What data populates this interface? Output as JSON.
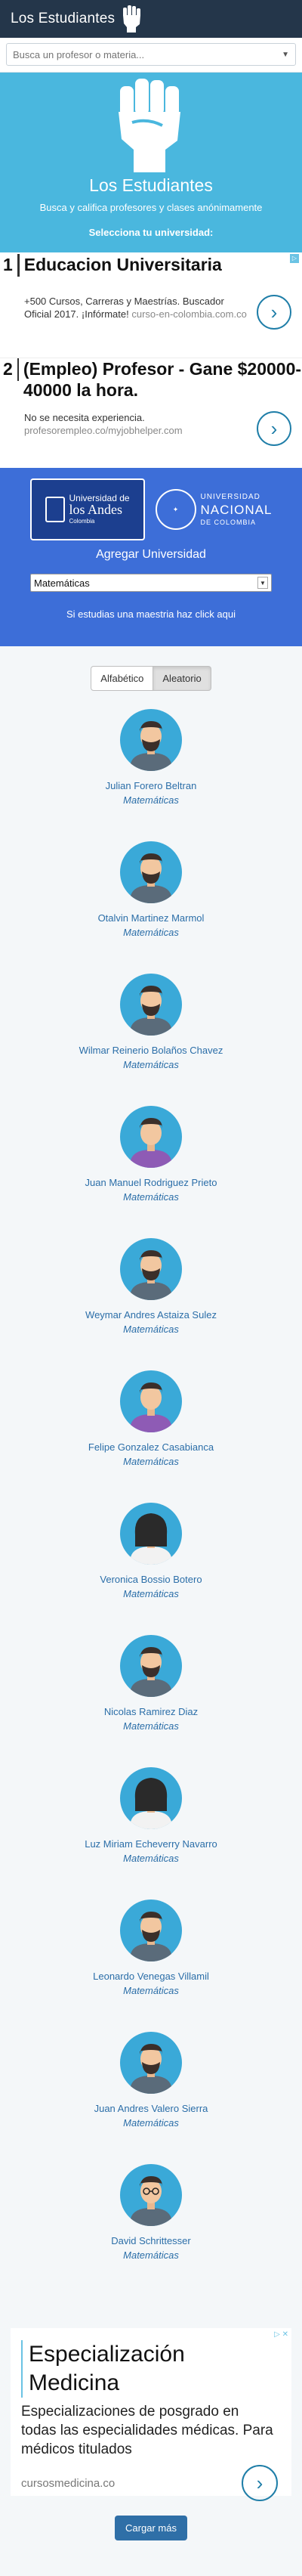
{
  "header": {
    "brand": "Los Estudiantes"
  },
  "search": {
    "placeholder": "Busca un profesor o materia..."
  },
  "hero": {
    "title": "Los Estudiantes",
    "subtitle": "Busca y califica profesores y clases anónimamente",
    "choose": "Selecciona tu universidad:"
  },
  "ads": {
    "ad1": {
      "number": "1",
      "title": "Educacion Universitaria",
      "body": "+500 Cursos, Carreras y Maestrías. Buscador Oficial 2017. ¡Infórmate!",
      "url": "curso-en-colombia.com.co"
    },
    "ad2": {
      "number": "2",
      "title": "(Empleo) Profesor - Gane $20000-40000 la hora.",
      "body": "No se necesita experiencia.",
      "url": "profesorempleo.co/myjobhelper.com"
    },
    "ad3": {
      "title": "Especialización Medicina",
      "body": "Especializaciones de posgrado en todas las especialidades médicas. Para médicos titulados",
      "url": "cursosmedicina.co"
    }
  },
  "universities": {
    "andes": {
      "line1": "Universidad de",
      "line2": "los Andes",
      "line3": "Colombia"
    },
    "nacional": {
      "line1": "UNIVERSIDAD",
      "line2": "NACIONAL",
      "line3": "DE COLOMBIA"
    },
    "add_label": "Agregar Universidad",
    "selected": "Matemáticas",
    "masters_note": "Si estudias una maestria haz click aqui"
  },
  "sort": {
    "alphabetic": "Alfabético",
    "random": "Aleatorio",
    "active": "random"
  },
  "professors": [
    {
      "name": "Julian Forero Beltran",
      "area": "Matemáticas",
      "avatar": "man-beard"
    },
    {
      "name": "Otalvin Martinez Marmol",
      "area": "Matemáticas",
      "avatar": "man-beard"
    },
    {
      "name": "Wilmar Reinerio Bolaños Chavez",
      "area": "Matemáticas",
      "avatar": "man-beard"
    },
    {
      "name": "Juan Manuel Rodriguez Prieto",
      "area": "Matemáticas",
      "avatar": "man-purple"
    },
    {
      "name": "Weymar Andres Astaiza Sulez",
      "area": "Matemáticas",
      "avatar": "man-beard"
    },
    {
      "name": "Felipe Gonzalez Casabianca",
      "area": "Matemáticas",
      "avatar": "man-purple"
    },
    {
      "name": "Veronica Bossio Botero",
      "area": "Matemáticas",
      "avatar": "woman"
    },
    {
      "name": "Nicolas Ramirez Diaz",
      "area": "Matemáticas",
      "avatar": "man-beard"
    },
    {
      "name": "Luz Miriam Echeverry Navarro",
      "area": "Matemáticas",
      "avatar": "woman"
    },
    {
      "name": "Leonardo Venegas Villamil",
      "area": "Matemáticas",
      "avatar": "man-beard"
    },
    {
      "name": "Juan Andres Valero Sierra",
      "area": "Matemáticas",
      "avatar": "man-beard"
    },
    {
      "name": "David Schrittesser",
      "area": "Matemáticas",
      "avatar": "man-glasses"
    }
  ],
  "load_more": "Cargar más",
  "colors": {
    "topbar": "#24364a",
    "hero": "#4ab7de",
    "unis": "#3d6ed8",
    "link": "#2b6ea8",
    "button": "#2f6fa7"
  }
}
